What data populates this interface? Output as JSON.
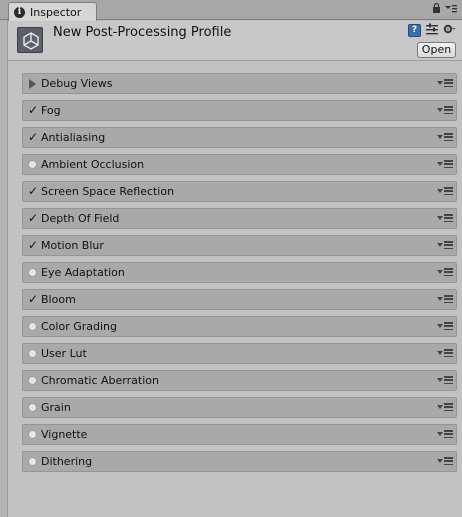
{
  "tab": {
    "title": "Inspector",
    "icon": "info-icon"
  },
  "header": {
    "title": "New Post-Processing Profile",
    "open_label": "Open",
    "icon": "unity-asset-icon"
  },
  "effects": [
    {
      "label": "Debug Views",
      "state": "collapsed"
    },
    {
      "label": "Fog",
      "state": "checked"
    },
    {
      "label": "Antialiasing",
      "state": "checked"
    },
    {
      "label": "Ambient Occlusion",
      "state": "unchecked"
    },
    {
      "label": "Screen Space Reflection",
      "state": "checked"
    },
    {
      "label": "Depth Of Field",
      "state": "checked"
    },
    {
      "label": "Motion Blur",
      "state": "checked"
    },
    {
      "label": "Eye Adaptation",
      "state": "unchecked"
    },
    {
      "label": "Bloom",
      "state": "checked"
    },
    {
      "label": "Color Grading",
      "state": "unchecked"
    },
    {
      "label": "User Lut",
      "state": "unchecked"
    },
    {
      "label": "Chromatic Aberration",
      "state": "unchecked"
    },
    {
      "label": "Grain",
      "state": "unchecked"
    },
    {
      "label": "Vignette",
      "state": "unchecked"
    },
    {
      "label": "Dithering",
      "state": "unchecked"
    }
  ],
  "colors": {
    "row_bg": "#a9a9a9",
    "panel_bg": "#c2c2c2",
    "book_icon": "#3b6ea8"
  }
}
